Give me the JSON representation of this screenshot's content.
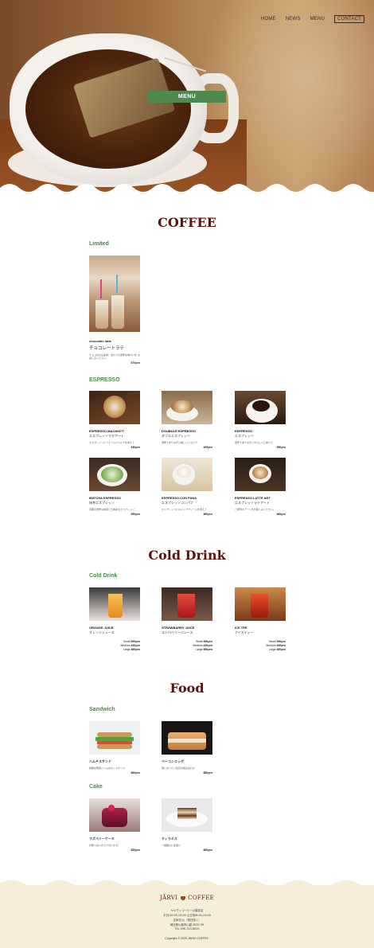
{
  "nav": {
    "items": [
      "HOME",
      "NEWS",
      "MENU",
      "CONTACT"
    ]
  },
  "hero": {
    "button_label": "MENU"
  },
  "coffee": {
    "title": "COFFEE",
    "limited_label": "Limited",
    "limited_item": {
      "en": "chocolate latte",
      "jp": "チョコレートラテ",
      "desc": "チョコ好きは是非！当たりの濃厚な味わいを お楽しみください。",
      "price": "670yen"
    },
    "espresso_label": "ESPRESSO",
    "espresso_items": [
      {
        "en": "ESPRESSO MACHIATT",
        "jp": "エスプレッソマキアート",
        "desc": "エスプレッソにフォームドミルクを添えて",
        "price": "440yen"
      },
      {
        "en": "DOUBULE ESPRESSO",
        "jp": "ダブルエスプレッソ",
        "desc": "濃厚でありながら優しいくちどけ",
        "price": "420yen"
      },
      {
        "en": "ESPRESSO",
        "jp": "エスプレッソ",
        "desc": "濃厚でありながらやさしい口あたり",
        "price": "390yen"
      },
      {
        "en": "MATCHA ESPRESSO",
        "jp": "抹茶エスプレッソ",
        "desc": "京都の濃厚な抹茶と日本産のエスプレッソ",
        "price": "390yen"
      },
      {
        "en": "ESPRESSO CON PANA",
        "jp": "エスプレッソコンパナ",
        "desc": "エスプレッソにホイップクリームを添えて",
        "price": "460yen"
      },
      {
        "en": "ESPRESSO LATTE ART",
        "jp": "エスプレッソラテアート",
        "desc": "ご希望のアートをお楽しみください。",
        "price": "460yen"
      }
    ]
  },
  "cold": {
    "title": "Cold Drink",
    "label": "Cold Drink",
    "items": [
      {
        "en": "ORANGE JUICE",
        "jp": "オレンジジュース",
        "small": "390yen",
        "medium": "440yen",
        "large": "460yen"
      },
      {
        "en": "STRAWBARRY JUICE",
        "jp": "ストロベリージュース",
        "small": "390yen",
        "medium": "440yen",
        "large": "460yen"
      },
      {
        "en": "ICE TEE",
        "jp": "アイスティー",
        "small": "390yen",
        "medium": "440yen",
        "large": "460yen"
      }
    ],
    "size_labels": {
      "small": "Small",
      "medium": "Medium",
      "large": "Large"
    }
  },
  "food": {
    "title": "Food",
    "sandwich_label": "Sandwich",
    "sandwich_items": [
      {
        "jp": "ハムチスサンド",
        "desc": "新鮮な野菜とハムのホットサンド",
        "price": "680yen"
      },
      {
        "jp": "ベーコンエッグ",
        "desc": "朝に食べたい最高の組み合わせ",
        "price": "680yen"
      }
    ],
    "cake_label": "Cake",
    "cake_items": [
      {
        "jp": "ラズベリーケーキ",
        "desc": "甘酸っぱいのでクセになる！",
        "price": "820yen"
      },
      {
        "jp": "ティラミス",
        "desc": "一緒飲むに最適に",
        "price": "680yen"
      }
    ]
  },
  "footer": {
    "logo_left": "JÄRVI",
    "logo_right": "COFFEE",
    "lines": [
      "ヤルヴィコーヒー川越支店",
      "平日/10:00-22:00 土日祝/8:00-23:00",
      "定休日/火（祝日除く）",
      "埼玉県川越市川越 2020-39",
      "TEL 090-725-8619"
    ],
    "copyright": "Copyright © 2020 JÄRVI COFFEE."
  },
  "colors": {
    "accent_green": "#4e8a4e",
    "title_brown": "#5a1410",
    "footer_bg": "#f6eed8"
  }
}
